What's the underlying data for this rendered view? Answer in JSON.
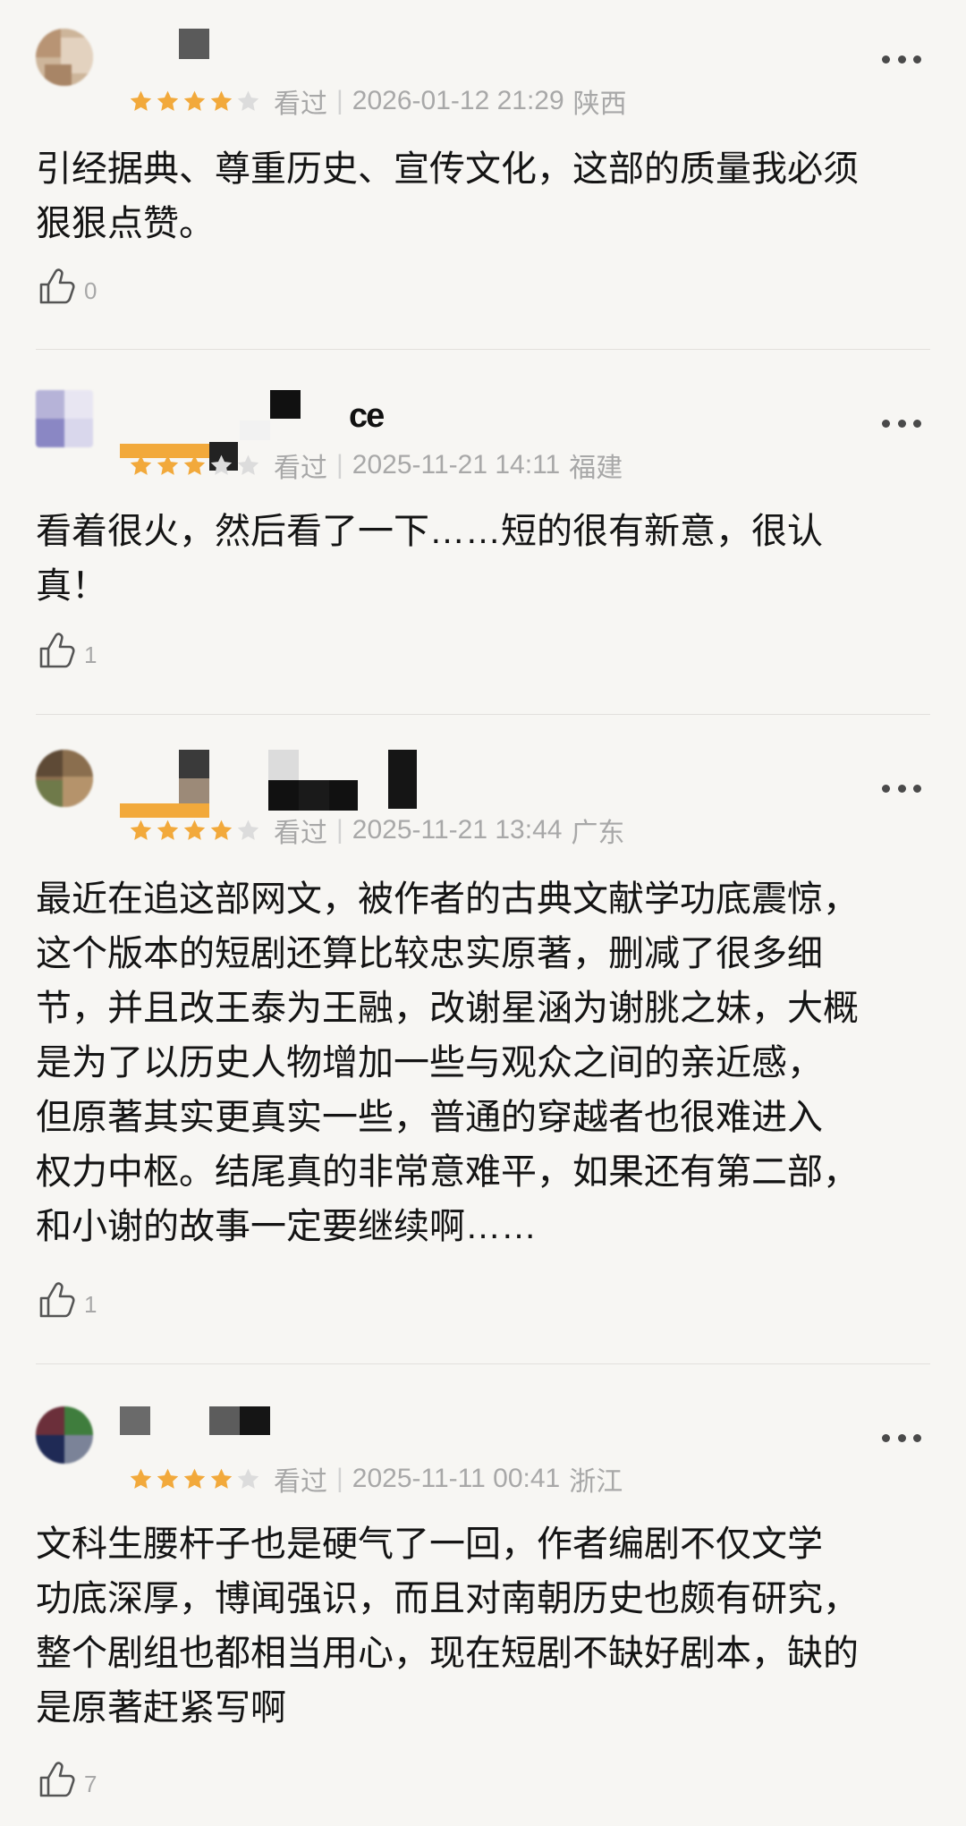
{
  "colors": {
    "star_active": "#f2a93b",
    "star_inactive": "#dcdcdc",
    "meta_text": "#a8a8a8",
    "background": "#f7f6f3"
  },
  "reviews": [
    {
      "name_visible": "",
      "rating": 4,
      "status": "看过",
      "datetime": "2026-01-12 21:29",
      "region": "陕西",
      "text": "引经据典、尊重历史、宣传文化，这部的质量我必须\n狠狠点赞。",
      "likes": "0"
    },
    {
      "name_visible": "ce",
      "rating": 3,
      "status": "看过",
      "datetime": "2025-11-21 14:11",
      "region": "福建",
      "text": "看着很火，然后看了一下……短的很有新意，很认\n真！",
      "likes": "1"
    },
    {
      "name_visible": "",
      "rating": 4,
      "status": "看过",
      "datetime": "2025-11-21 13:44",
      "region": "广东",
      "text": "最近在追这部网文，被作者的古典文献学功底震惊，\n这个版本的短剧还算比较忠实原著，删减了很多细\n节，并且改王泰为王融，改谢星涵为谢朓之妹，大概\n是为了以历史人物增加一些与观众之间的亲近感，\n但原著其实更真实一些，普通的穿越者也很难进入\n权力中枢。结尾真的非常意难平，如果还有第二部，\n和小谢的故事一定要继续啊……",
      "likes": "1"
    },
    {
      "name_visible": "",
      "rating": 4,
      "status": "看过",
      "datetime": "2025-11-11 00:41",
      "region": "浙江",
      "text": "文科生腰杆子也是硬气了一回，作者编剧不仅文学\n功底深厚，博闻强识，而且对南朝历史也颇有研究，\n整个剧组也都相当用心，现在短剧不缺好剧本，缺的\n是原著赶紧写啊",
      "likes": "7"
    }
  ]
}
